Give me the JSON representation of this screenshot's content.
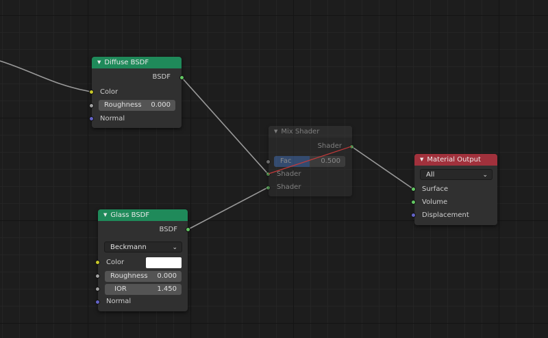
{
  "colors": {
    "shader_socket": "#63c763",
    "color_socket": "#c7c729",
    "float_socket": "#a1a1a1",
    "vector_socket": "#6363c7",
    "diffuse_header": "#1f8a5a",
    "glass_header": "#1f8a5a",
    "mix_header": "#1f8a5a",
    "output_header": "#a1313c",
    "glass_color_value": "#ffffff"
  },
  "diffuse": {
    "title": "Diffuse BSDF",
    "output_label": "BSDF",
    "color_label": "Color",
    "roughness_label": "Roughness",
    "roughness_value": "0.000",
    "normal_label": "Normal"
  },
  "glass": {
    "title": "Glass BSDF",
    "output_label": "BSDF",
    "distribution": "Beckmann",
    "color_label": "Color",
    "roughness_label": "Roughness",
    "roughness_value": "0.000",
    "ior_label": "IOR",
    "ior_value": "1.450",
    "normal_label": "Normal"
  },
  "mix": {
    "title": "Mix Shader",
    "output_label": "Shader",
    "fac_label": "Fac",
    "fac_value": "0.500",
    "fac_fraction": 0.5,
    "shader1_label": "Shader",
    "shader2_label": "Shader"
  },
  "output": {
    "title": "Material Output",
    "target": "All",
    "surface_label": "Surface",
    "volume_label": "Volume",
    "displacement_label": "Displacement"
  }
}
